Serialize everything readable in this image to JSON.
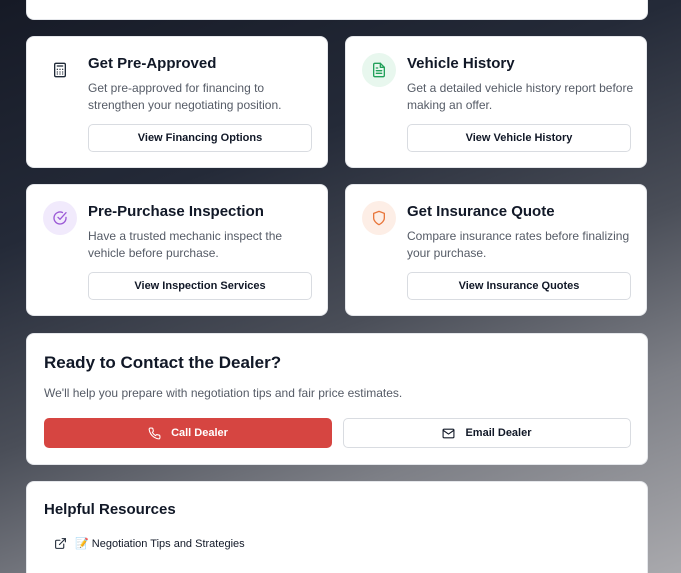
{
  "features": [
    {
      "title": "Get Pre-Approved",
      "description": "Get pre-approved for financing to strengthen your negotiating position.",
      "button": "View Financing Options",
      "icon": "calculator-icon",
      "icon_color": "#1f2937"
    },
    {
      "title": "Vehicle History",
      "description": "Get a detailed vehicle history report before making an offer.",
      "button": "View Vehicle History",
      "icon": "document-icon",
      "icon_color": "#22a05a"
    },
    {
      "title": "Pre-Purchase Inspection",
      "description": "Have a trusted mechanic inspect the vehicle before purchase.",
      "button": "View Inspection Services",
      "icon": "check-circle-icon",
      "icon_color": "#9b59d6"
    },
    {
      "title": "Get Insurance Quote",
      "description": "Compare insurance rates before finalizing your purchase.",
      "button": "View Insurance Quotes",
      "icon": "shield-icon",
      "icon_color": "#e8763b"
    }
  ],
  "contact": {
    "title": "Ready to Contact the Dealer?",
    "description": "We'll help you prepare with negotiation tips and fair price estimates.",
    "call_label": "Call Dealer",
    "email_label": "Email Dealer",
    "call_color": "#d64541"
  },
  "resources": {
    "title": "Helpful Resources",
    "links": [
      {
        "emoji": "📝",
        "label": "Negotiation Tips and Strategies"
      }
    ]
  }
}
